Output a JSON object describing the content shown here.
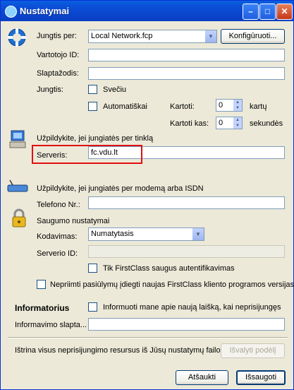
{
  "window": {
    "title": "Nustatymai"
  },
  "connection": {
    "via_label": "Jungtis per:",
    "via_value": "Local Network.fcp",
    "configure_button": "Konfigūruoti...",
    "user_id_label": "Vartotojo ID:",
    "user_id_value": "",
    "password_label": "Slaptažodis:",
    "password_value": "",
    "connect_label": "Jungtis:",
    "guest_label": "Svečiu",
    "auto_label": "Automatiškai",
    "repeat_label": "Kartoti:",
    "repeat_value": "0",
    "repeat_unit": "kartų",
    "repeat_every_label": "Kartoti kas:",
    "repeat_every_value": "0",
    "repeat_every_unit": "sekundės"
  },
  "network": {
    "heading": "Užpildykite, jei jungiatės per tinklą",
    "server_label": "Serveris:",
    "server_value": "fc.vdu.lt"
  },
  "modem": {
    "heading": "Užpildykite, jei jungiatės per modemą arba ISDN",
    "phone_label": "Telefono Nr.:",
    "phone_value": ""
  },
  "security": {
    "heading": "Saugumo nustatymai",
    "encoding_label": "Kodavimas:",
    "encoding_value": "Numatytasis",
    "server_id_label": "Serverio ID:",
    "server_id_value": "",
    "secure_auth_label": "Tik FirstClass saugus autentifikavimas"
  },
  "updates": {
    "decline_label": "Nepriimti pasiūlymų įdiegti naujas FirstClass kliento programos versijas"
  },
  "notifier": {
    "heading": "Informatorius",
    "notify_label": "Informuoti mane apie naują laišką, kai neprisijungęs",
    "password_label": "Informavimo slapta...",
    "password_value": ""
  },
  "offline": {
    "text": "Ištrina visus neprisijungimo resursus iš Jūsų nustatymų failo",
    "clear_button": "Išvalyti podėlį"
  },
  "footer": {
    "cancel_button": "Atšaukti",
    "save_button": "Išsaugoti"
  }
}
